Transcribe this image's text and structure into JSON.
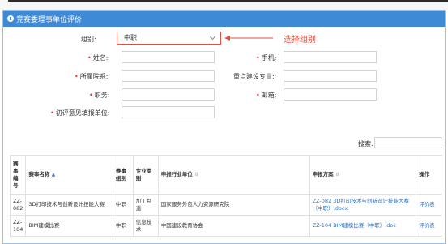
{
  "panel": {
    "title": "竞赛委理事单位评价"
  },
  "form": {
    "group_label": "组别:",
    "group_value": "中职",
    "annotation": "选择组别",
    "name_label": "姓名:",
    "phone_label": "手机:",
    "dept_label": "所属院系:",
    "major_label": "重点建设专业:",
    "title_label": "职务:",
    "email_label": "邮箱:",
    "initial_unit_label": "初评意见填报单位:"
  },
  "search": {
    "label": "搜索:"
  },
  "table": {
    "headers": [
      "赛事编号",
      "赛事名称",
      "赛事组别",
      "专业类别",
      "申报行业单位",
      "申报方案",
      "操作"
    ],
    "rows": [
      {
        "id": "ZZ-082",
        "name": "3D打印技术与创新设计技能大赛",
        "group": "中职",
        "category": "加工制造",
        "unit": "国家服务外包人力资源研究院",
        "plan": "ZZ-082 3D打印技术与创新设计技能大赛（中职）.docx",
        "action": "评价表"
      },
      {
        "id": "ZZ-104",
        "name": "BIM建模比赛",
        "group": "中职",
        "category": "信息技术",
        "unit": "中国建设教育协会",
        "plan": "ZZ-104 BIM建模比赛（中职）.doc",
        "action": "评价表"
      }
    ]
  },
  "colors": {
    "header_bg": "#3f8ad7",
    "accent_red": "#e74c3c",
    "link": "#2f73c4"
  },
  "icons": [
    "info-icon",
    "chevron-down-icon",
    "sort-icon",
    "arrow-annotation"
  ]
}
